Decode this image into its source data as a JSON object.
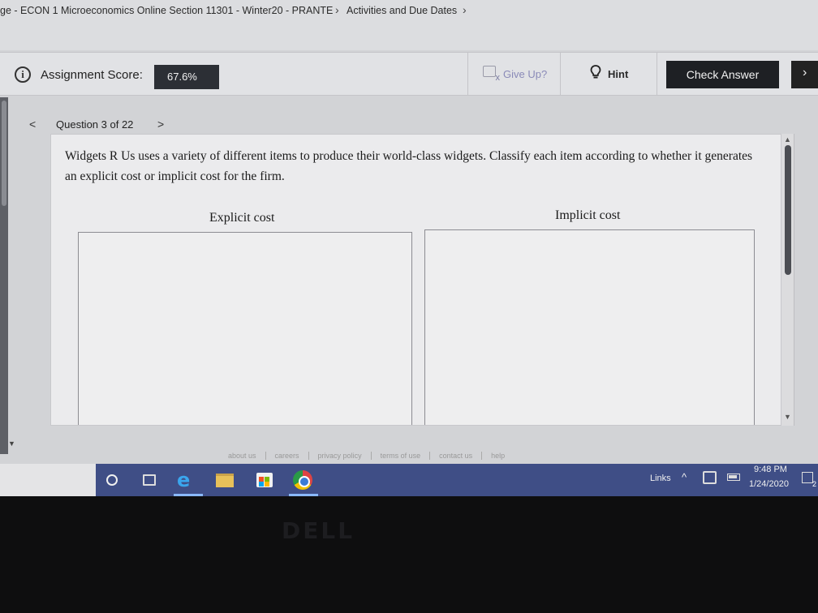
{
  "breadcrumb": {
    "course": "ge - ECON 1 Microeconomics Online Section 11301 - Winter20 - PRANTE",
    "section": "Activities and Due Dates",
    "separator": "›"
  },
  "toolbar": {
    "score_label": "Assignment Score:",
    "score_value": "67.6%",
    "give_up_label": "Give Up?",
    "hint_label": "Hint",
    "check_answer_label": "Check Answer"
  },
  "question_nav": {
    "prev_symbol": "<",
    "label": "Question 3 of 22",
    "next_symbol": ">"
  },
  "question": {
    "text": "Widgets R Us uses a variety of different items to produce their world-class widgets. Classify each item according to whether it generates an explicit cost or implicit cost for the firm.",
    "column_explicit": "Explicit cost",
    "column_implicit": "Implicit cost"
  },
  "footer": {
    "links": [
      "about us",
      "careers",
      "privacy policy",
      "terms of use",
      "contact us",
      "help"
    ]
  },
  "taskbar": {
    "links_label": "Links",
    "time": "9:48 PM",
    "date": "1/24/2020",
    "notification_count": "2"
  },
  "bezel": {
    "brand": "DELL"
  },
  "colors": {
    "check_answer_bg": "#1e2024",
    "score_bg": "#2c2f35",
    "taskbar_bg": "#3f4e86",
    "give_up_text": "#8a8ab8"
  },
  "icons": [
    "info-icon",
    "give-up-icon",
    "hint-icon",
    "start-icon",
    "task-view-icon",
    "edge-icon",
    "file-explorer-icon",
    "store-icon",
    "chrome-icon",
    "tray-app-icon",
    "battery-icon",
    "notification-icon"
  ]
}
